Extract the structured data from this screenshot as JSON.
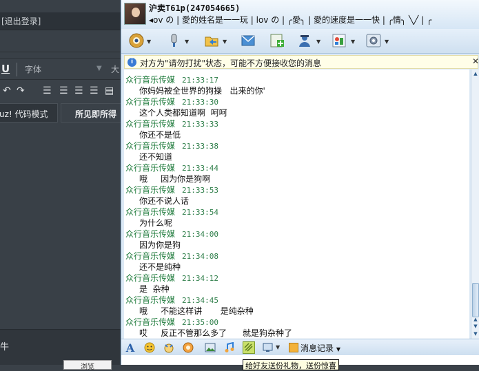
{
  "background_window": {
    "logout_text": "[退出登录]",
    "font_label": "字体",
    "size_label": "大",
    "code_mode_tab": "uz! 代码模式",
    "wysiwyg_tab": "所见即所得",
    "footer_text": "牛",
    "footer_button": "浏览"
  },
  "chat": {
    "contact_name": "沪卖T61p(247054665)",
    "signature": "◂ov の | 愛的姓名是一一玩  | lov の  | ╭愛╮ | 愛的速度是一一快  | ╭情╮  ╲╱ | ╭",
    "notice": "对方为\"请勿打扰\"状态，可能不方便接收您的消息",
    "messages": [
      {
        "sender": "众行音乐传媒",
        "time": "21:33:17",
        "text": "你妈妈被全世界的狗操   出来的你'"
      },
      {
        "sender": "众行音乐传媒",
        "time": "21:33:30",
        "text": "这个人类都知道啊  呵呵"
      },
      {
        "sender": "众行音乐传媒",
        "time": "21:33:33",
        "text": "你还不是低"
      },
      {
        "sender": "众行音乐传媒",
        "time": "21:33:38",
        "text": "还不知道"
      },
      {
        "sender": "众行音乐传媒",
        "time": "21:33:44",
        "text": "哦     因为你是狗啊"
      },
      {
        "sender": "众行音乐传媒",
        "time": "21:33:53",
        "text": "你还不说人话"
      },
      {
        "sender": "众行音乐传媒",
        "time": "21:33:54",
        "text": "为什么呢"
      },
      {
        "sender": "众行音乐传媒",
        "time": "21:34:00",
        "text": "因为你是狗"
      },
      {
        "sender": "众行音乐传媒",
        "time": "21:34:08",
        "text": "还不是纯种"
      },
      {
        "sender": "众行音乐传媒",
        "time": "21:34:12",
        "text": "是  杂种"
      },
      {
        "sender": "众行音乐传媒",
        "time": "21:34:45",
        "text": "哦     不能这样讲       是纯杂种"
      },
      {
        "sender": "众行音乐传媒",
        "time": "21:35:00",
        "text": "哎     反正不管那么多了      就是狗杂种了"
      }
    ],
    "history_label": "消息记录",
    "tooltip": "给好友送份礼物，送份惊喜"
  },
  "icons": {
    "toolbar": [
      "video-chat-icon",
      "voice-chat-icon",
      "send-file-icon",
      "email-icon",
      "add-app-icon",
      "block-user-icon",
      "app-store-icon",
      "settings-icon"
    ],
    "input_toolbar": [
      "font-icon",
      "emoticon-icon",
      "magic-face-icon",
      "shake-icon",
      "image-icon",
      "music-icon",
      "gift-icon",
      "screenshot-icon"
    ]
  },
  "colors": {
    "sender": "#1d7a3a",
    "accent_blue": "#3a7bd5"
  }
}
